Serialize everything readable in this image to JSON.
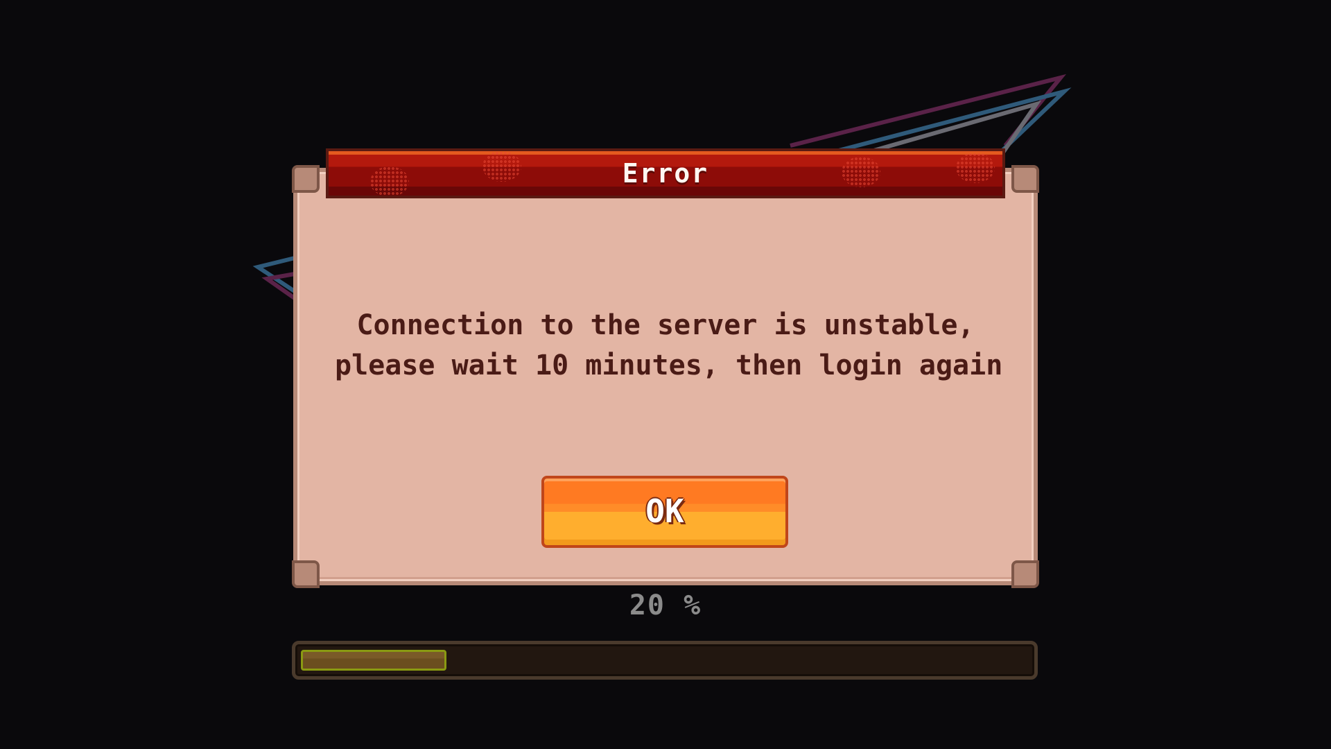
{
  "dialog": {
    "title": "Error",
    "message_line1": "Connection to the server is unstable,",
    "message_line2": "please wait 10 minutes, then login again",
    "ok_label": "OK"
  },
  "loading": {
    "percent_label": "20 %",
    "progress_fraction": 0.2
  },
  "colors": {
    "background": "#0a090c",
    "dialog_body": "#e3b5a4",
    "title_bar": "#8d0c08",
    "button": "#ff8c28",
    "message_text": "#4a1b16"
  }
}
